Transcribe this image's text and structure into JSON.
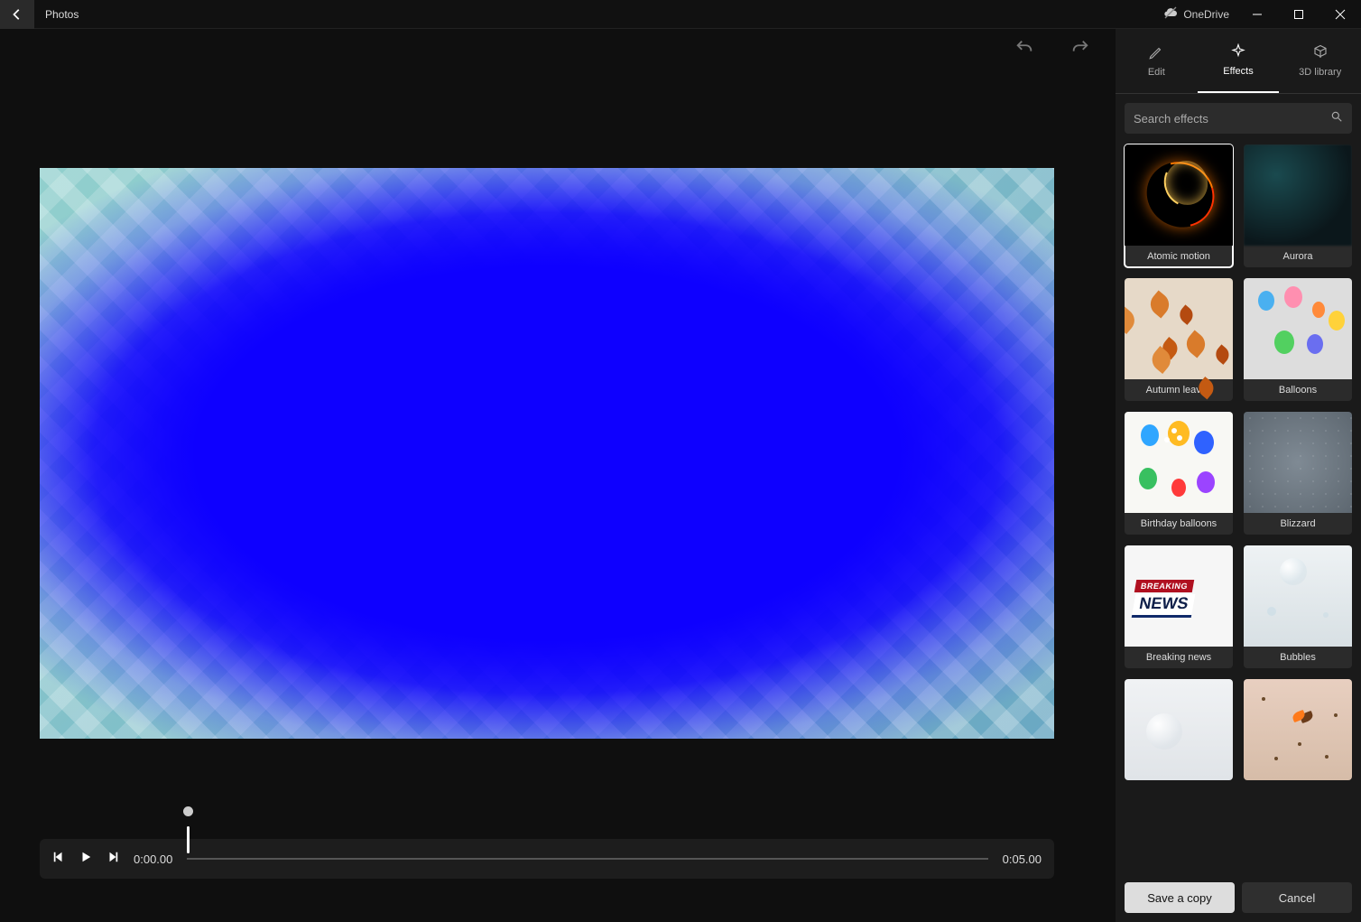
{
  "app": {
    "title": "Photos"
  },
  "cloud": {
    "label": "OneDrive"
  },
  "tabs": {
    "edit": "Edit",
    "effects": "Effects",
    "library3d": "3D library",
    "active": "effects"
  },
  "search": {
    "placeholder": "Search effects"
  },
  "playback": {
    "current": "0:00.00",
    "total": "0:05.00"
  },
  "effects": [
    {
      "id": "atomic",
      "label": "Atomic motion",
      "thumb": "th-atomic",
      "selected": true
    },
    {
      "id": "aurora",
      "label": "Aurora",
      "thumb": "th-aurora",
      "selected": false
    },
    {
      "id": "autumn",
      "label": "Autumn leaves",
      "thumb": "th-autumn",
      "selected": false
    },
    {
      "id": "balloons",
      "label": "Balloons",
      "thumb": "th-balloons",
      "selected": false
    },
    {
      "id": "birthday",
      "label": "Birthday balloons",
      "thumb": "th-birthday",
      "selected": false
    },
    {
      "id": "blizzard",
      "label": "Blizzard",
      "thumb": "th-blizzard",
      "selected": false
    },
    {
      "id": "breaking",
      "label": "Breaking news",
      "thumb": "th-breaking",
      "selected": false
    },
    {
      "id": "bubbles",
      "label": "Bubbles",
      "thumb": "th-bubbles",
      "selected": false
    },
    {
      "id": "extra1",
      "label": "",
      "thumb": "th-bubbles2",
      "selected": false
    },
    {
      "id": "extra2",
      "label": "",
      "thumb": "th-butterfly",
      "selected": false
    }
  ],
  "actions": {
    "save": "Save a copy",
    "cancel": "Cancel"
  }
}
